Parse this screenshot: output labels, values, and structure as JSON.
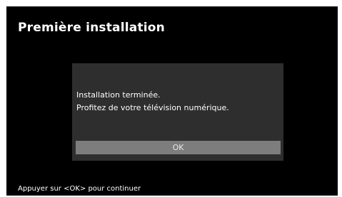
{
  "screen": {
    "title": "Première installation"
  },
  "dialog": {
    "message_line1": "Installation terminée.",
    "message_line2": "Profitez de votre télévision numérique.",
    "ok_label": "OK"
  },
  "footer": {
    "hint": "Appuyer sur <OK> pour continuer"
  },
  "colors": {
    "background": "#000000",
    "dialog_background": "#2e2e2e",
    "button_highlight": "#7d7d7d",
    "text": "#ffffff"
  }
}
